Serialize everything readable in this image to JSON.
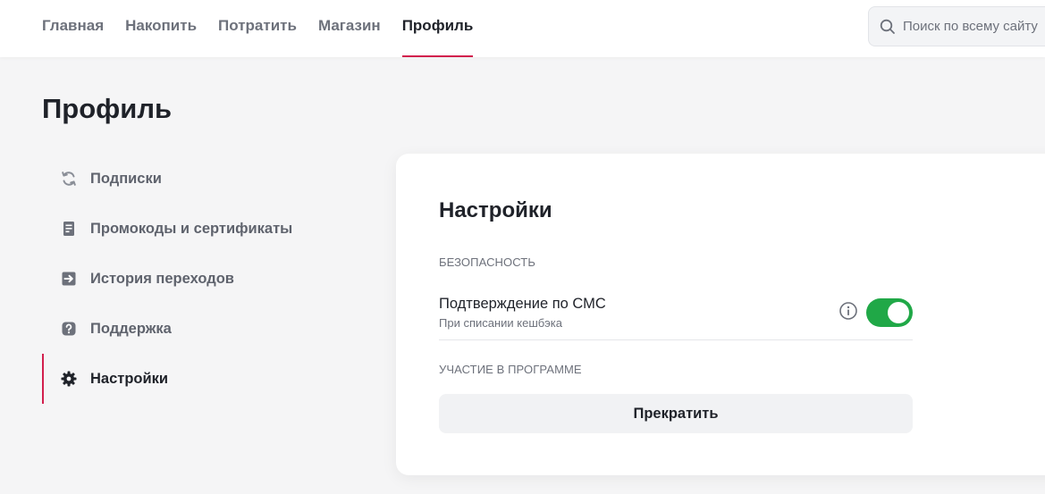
{
  "nav": {
    "items": [
      {
        "label": "Главная"
      },
      {
        "label": "Накопить"
      },
      {
        "label": "Потратить"
      },
      {
        "label": "Магазин"
      },
      {
        "label": "Профиль",
        "active": true
      }
    ],
    "search_placeholder": "Поиск по всему сайту",
    "search_icon": "search-icon"
  },
  "page": {
    "title": "Профиль"
  },
  "sidebar": {
    "items": [
      {
        "label": "Подписки",
        "icon": "refresh-icon"
      },
      {
        "label": "Промокоды и сертификаты",
        "icon": "receipt-icon"
      },
      {
        "label": "История переходов",
        "icon": "arrow-right-box-icon"
      },
      {
        "label": "Поддержка",
        "icon": "question-icon"
      },
      {
        "label": "Настройки",
        "icon": "gear-icon",
        "active": true
      }
    ]
  },
  "settings": {
    "title": "Настройки",
    "security_label": "БЕЗОПАСНОСТЬ",
    "sms": {
      "title": "Подтверждение по СМС",
      "subtitle": "При списании кешбэка",
      "enabled": true
    },
    "program_label": "УЧАСТИЕ В ПРОГРАММЕ",
    "stop_button": "Прекратить"
  },
  "colors": {
    "accent": "#d21f4d",
    "toggle_on": "#20a847",
    "background": "#f5f5f6"
  }
}
